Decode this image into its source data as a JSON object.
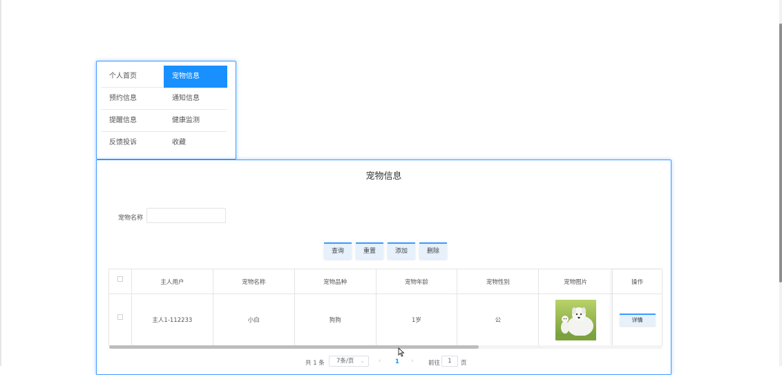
{
  "menu": {
    "items": [
      {
        "label": "个人首页",
        "active": false
      },
      {
        "label": "宠物信息",
        "active": true
      },
      {
        "label": "预约信息",
        "active": false
      },
      {
        "label": "通知信息",
        "active": false
      },
      {
        "label": "提醒信息",
        "active": false
      },
      {
        "label": "健康监测",
        "active": false
      },
      {
        "label": "反馈投诉",
        "active": false
      },
      {
        "label": "收藏",
        "active": false
      }
    ]
  },
  "panel": {
    "title": "宠物信息",
    "search": {
      "label": "宠物名称",
      "value": "",
      "placeholder": ""
    },
    "buttons": {
      "query": "查询",
      "reset": "重置",
      "add": "添加",
      "delete": "删除"
    }
  },
  "table": {
    "columns": [
      "主人用户",
      "宠物名称",
      "宠物品种",
      "宠物年龄",
      "宠物性别",
      "宠物图片",
      "操作"
    ],
    "rows": [
      {
        "owner": "主人1-112233",
        "name": "小白",
        "breed": "狗狗",
        "age": "1岁",
        "gender": "公",
        "image_icon": "dog-photo",
        "action": "详情"
      }
    ]
  },
  "pagination": {
    "total": "共 1 条",
    "page_size": "7条/页",
    "current": "1",
    "goto_label": "前往",
    "goto_value": "1",
    "page_label": "页"
  },
  "colors": {
    "accent": "#1890ff",
    "border": "#3a99ff"
  }
}
